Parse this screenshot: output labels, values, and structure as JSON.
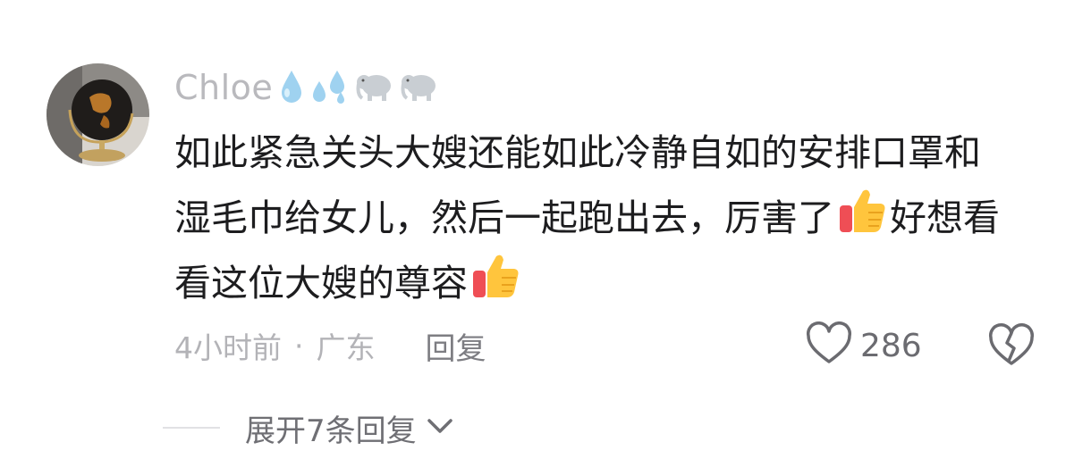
{
  "comment": {
    "username": "Chloe",
    "name_emojis": [
      "droplet-icon",
      "sweat-droplets-icon",
      "elephant-icon",
      "elephant-icon"
    ],
    "text_lines": [
      {
        "text": "如此紧急关头大嫂还能如此冷静自如的安排口罩和",
        "after": "",
        "thumb": false
      },
      {
        "text": "湿毛巾给女儿，然后一起跑出去，厉害了",
        "after": "好想看",
        "thumb": true
      },
      {
        "text": "看这位大嫂的尊容",
        "after": "",
        "thumb": true
      }
    ],
    "time": "4小时前",
    "dot": "·",
    "location": "广东",
    "reply_label": "回复",
    "like_count": "286",
    "expand_label": "展开7条回复"
  },
  "colors": {
    "text": "#1d1d1f",
    "muted": "#b3b3b7",
    "reply": "#7d7d82",
    "icon": "#6b6b70",
    "background": "#ffffff"
  }
}
